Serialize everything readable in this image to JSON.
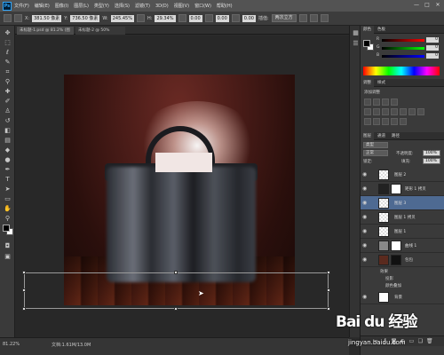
{
  "app": {
    "logo": "Ps"
  },
  "menu": [
    "文件(F)",
    "编辑(E)",
    "图像(I)",
    "图层(L)",
    "类型(Y)",
    "选择(S)",
    "滤镜(T)",
    "3D(D)",
    "视图(V)",
    "窗口(W)",
    "帮助(H)"
  ],
  "window_controls": [
    "—",
    "□",
    "✕"
  ],
  "options": {
    "x_label": "X:",
    "x_value": "381.50 像素",
    "y_label": "Y:",
    "y_value": "736.50 像素",
    "w_label": "W:",
    "w_value": "245.45%",
    "h_label": "H:",
    "h_value": "29.34%",
    "angle_value": "0.00",
    "h_skew": "0.00",
    "v_skew": "0.00",
    "interp_label": "插值:",
    "interp_value": "两次立方"
  },
  "tabs": [
    {
      "label": "未标题-1.psd @ 81.2% (图层 1, RGB/8)"
    },
    {
      "label": "未标题-2 @ 50% (RGB/8)"
    }
  ],
  "status": {
    "zoom": "81.22%",
    "doc": "文档:1.61M/13.0M"
  },
  "panels": {
    "color_tabs": [
      "颜色",
      "色板"
    ],
    "sliders": [
      {
        "label": "R",
        "value": "0",
        "color": "#e04040"
      },
      {
        "label": "G",
        "value": "0",
        "color": "#40c040"
      },
      {
        "label": "B",
        "value": "0",
        "color": "#4060e0"
      }
    ],
    "adjust_tabs": [
      "调整",
      "样式"
    ],
    "adjust_title": "添加调整",
    "layers_tabs": [
      "图层",
      "通道",
      "路径"
    ],
    "blend_mode": "正常",
    "opacity_label": "不透明度:",
    "opacity_value": "100%",
    "lock_label": "锁定:",
    "fill_label": "填充:",
    "fill_value": "100%",
    "kind_label": "类型"
  },
  "layers": [
    {
      "name": "图层 2",
      "selected": false
    },
    {
      "name": "矩形 1 拷贝",
      "selected": false,
      "has_mask": true
    },
    {
      "name": "图层 3",
      "selected": true
    },
    {
      "name": "图层 1 拷贝",
      "selected": false
    },
    {
      "name": "图层 1",
      "selected": false
    },
    {
      "name": "曲线 1",
      "selected": false,
      "has_mask": true
    },
    {
      "name": "包包",
      "selected": false,
      "has_mask": true
    },
    {
      "name": "背景",
      "selected": false
    }
  ],
  "fx_lines": [
    "效果",
    "投影",
    "颜色叠加"
  ],
  "watermark": {
    "logo": "Bai du 经验",
    "url": "jingyan.baidu.com"
  }
}
